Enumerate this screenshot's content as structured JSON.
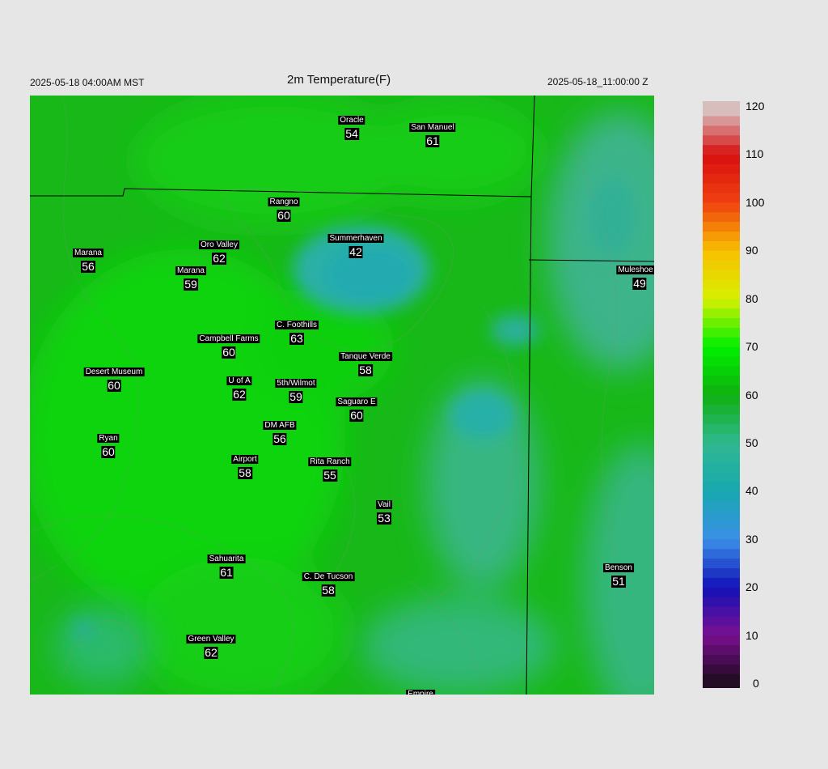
{
  "header": {
    "local_time": "2025-05-18 04:00AM MST",
    "title": "2m Temperature(F)",
    "utc_time": "2025-05-18_11:00:00 Z"
  },
  "colorbar": {
    "ticks": [
      "120",
      "110",
      "100",
      "90",
      "80",
      "70",
      "60",
      "50",
      "40",
      "30",
      "20",
      "10",
      "0"
    ],
    "min": 0,
    "max": 120,
    "colors": {
      "0": "#1a0a1a",
      "10": "#7a1090",
      "20": "#1212b8",
      "30": "#3a90e8",
      "40": "#18a8b0",
      "50": "#30b890",
      "60": "#10b010",
      "70": "#00f000",
      "80": "#d8f000",
      "90": "#f8c000",
      "100": "#f04010",
      "110": "#d81010",
      "120": "#d8d0d0"
    }
  },
  "stations": [
    {
      "id": "oracle",
      "name": "Oracle",
      "value": "54"
    },
    {
      "id": "san-manuel",
      "name": "San Manuel",
      "value": "61"
    },
    {
      "id": "rangno",
      "name": "Rangno",
      "value": "60"
    },
    {
      "id": "summerhaven",
      "name": "Summerhaven",
      "value": "42"
    },
    {
      "id": "marana-west",
      "name": "Marana",
      "value": "56"
    },
    {
      "id": "oro-valley",
      "name": "Oro Valley",
      "value": "62"
    },
    {
      "id": "marana",
      "name": "Marana",
      "value": "59"
    },
    {
      "id": "muleshoe-r",
      "name": "Muleshoe R",
      "value": "49"
    },
    {
      "id": "c-foothills",
      "name": "C. Foothills",
      "value": "63"
    },
    {
      "id": "campbell-farms",
      "name": "Campbell Farms",
      "value": "60"
    },
    {
      "id": "tanque-verde",
      "name": "Tanque Verde",
      "value": "58"
    },
    {
      "id": "desert-museum",
      "name": "Desert Museum",
      "value": "60"
    },
    {
      "id": "u-of-a",
      "name": "U of A",
      "value": "62"
    },
    {
      "id": "5th-wilmot",
      "name": "5th/Wilmot",
      "value": "59"
    },
    {
      "id": "saguaro-e",
      "name": "Saguaro E",
      "value": "60"
    },
    {
      "id": "dm-afb",
      "name": "DM AFB",
      "value": "56"
    },
    {
      "id": "ryan",
      "name": "Ryan",
      "value": "60"
    },
    {
      "id": "airport",
      "name": "Airport",
      "value": "58"
    },
    {
      "id": "rita-ranch",
      "name": "Rita Ranch",
      "value": "55"
    },
    {
      "id": "vail",
      "name": "Vail",
      "value": "53"
    },
    {
      "id": "sahuarita",
      "name": "Sahuarita",
      "value": "61"
    },
    {
      "id": "c-de-tucson",
      "name": "C. De Tucson",
      "value": "58"
    },
    {
      "id": "benson",
      "name": "Benson",
      "value": "51"
    },
    {
      "id": "green-valley",
      "name": "Green Valley",
      "value": "62"
    },
    {
      "id": "empire",
      "name": "Empire",
      "value": ""
    }
  ]
}
